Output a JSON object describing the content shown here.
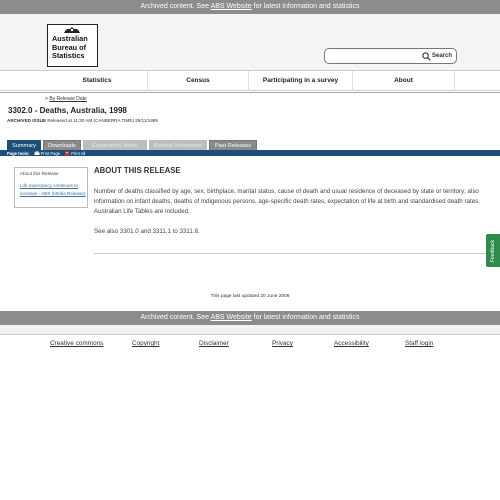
{
  "archive_banner": {
    "before": "Archived content. See ",
    "link": "ABS Website",
    "after": " for latest information and statistics"
  },
  "logo": {
    "line1": "Australian",
    "line2": "Bureau of",
    "line3": "Statistics",
    "icon": "coat-of-arms-icon"
  },
  "search": {
    "placeholder": "",
    "button_label": "Search",
    "icon": "search-icon"
  },
  "nav": {
    "items": [
      "Statistics",
      "Census",
      "Participating in a survey",
      "About"
    ]
  },
  "breadcrumb": {
    "prefix": "> ",
    "link": "By Release Date"
  },
  "page_title": "3302.0 - Deaths, Australia, 1998",
  "release": {
    "label": "ARCHIVED ISSUE",
    "text": " Released at 11:30 AM (CANBERRA TIME) 29/11/1999"
  },
  "tabs": [
    {
      "label": "Summary",
      "state": "active"
    },
    {
      "label": "Downloads",
      "state": "normal"
    },
    {
      "label": "Explanatory Notes",
      "state": "disabled"
    },
    {
      "label": "Related Information",
      "state": "disabled"
    },
    {
      "label": "Past Releases",
      "state": "normal"
    }
  ],
  "page_tools": {
    "label": "Page tools:",
    "print": "Print Page",
    "print_all": "Print All",
    "print_icon": "printer-icon",
    "print_all_icon": "pdf-icon"
  },
  "sidebar": {
    "title": "About this Release",
    "link": "Life expectancy continues to increase - ABS (Media Release)"
  },
  "main": {
    "heading": "ABOUT THIS RELEASE",
    "body": "Number of deaths classified by age, sex, birthplace, marital status, cause of death and usual residence of deceased by state or territory; also information on infant deaths, deaths of Indigenous persons, age-specific death rates, expectation of life at birth and standardised death rates. Australian Life Tables are included.",
    "see_also": "See also 3301.0 and 3311.1 to 3311.8."
  },
  "feedback_label": "Feedback",
  "last_updated": "This page last updated 20 June 2006",
  "footer": {
    "links": [
      "Creative commons",
      "Copyright",
      "Disclaimer",
      "Privacy",
      "Accessibility",
      "Staff login"
    ]
  },
  "colors": {
    "archive_bar": "#8c8c8c",
    "tab_active": "#1d4d79",
    "feedback": "#2f8a4e",
    "link": "#3a6da0"
  }
}
